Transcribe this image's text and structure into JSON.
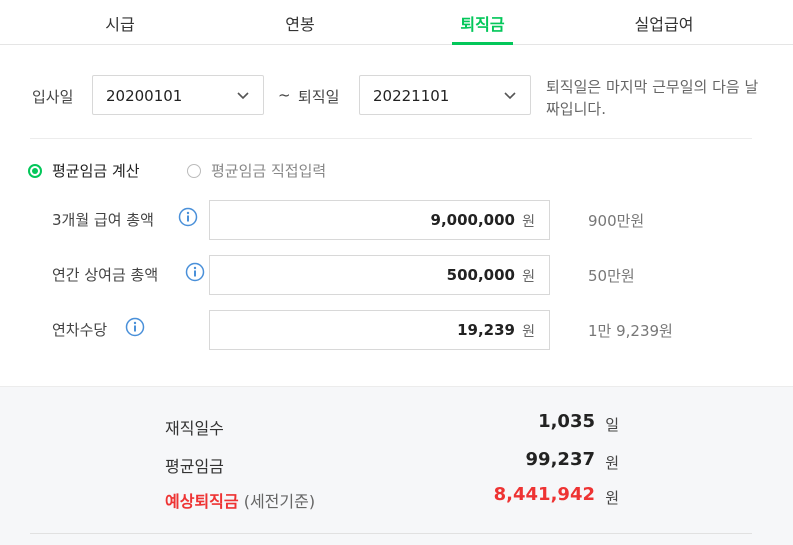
{
  "tabs": [
    {
      "label": "시급",
      "active": false
    },
    {
      "label": "연봉",
      "active": false
    },
    {
      "label": "퇴직금",
      "active": true
    },
    {
      "label": "실업급여",
      "active": false
    }
  ],
  "dates": {
    "start_label": "입사일",
    "start_value": "20200101",
    "separator": "~",
    "end_label": "퇴직일",
    "end_value": "20221101",
    "note": "퇴직일은 마지막 근무일의 다음 날짜입니다."
  },
  "mode": {
    "option1": "평균임금 계산",
    "option2": "평균임금 직접입력",
    "selected": "평균임금 계산"
  },
  "fields": [
    {
      "label": "3개월 급여 총액",
      "value": "9,000,000",
      "unit": "원",
      "korean": "900만원"
    },
    {
      "label": "연간 상여금 총액",
      "value": "500,000",
      "unit": "원",
      "korean": "50만원"
    },
    {
      "label": "연차수당",
      "value": "19,239",
      "unit": "원",
      "korean": "1만 9,239원"
    }
  ],
  "result": {
    "days_label": "재직일수",
    "days_value": "1,035",
    "days_unit": "일",
    "avg_label": "평균임금",
    "avg_value": "99,237",
    "avg_unit": "원",
    "severance_label": "예상퇴직금",
    "severance_sub": "(세전기준)",
    "severance_value": "8,441,942",
    "severance_unit": "원"
  },
  "colors": {
    "accent": "#03c75a",
    "highlight": "#e33333",
    "info": "#4a90d9"
  }
}
